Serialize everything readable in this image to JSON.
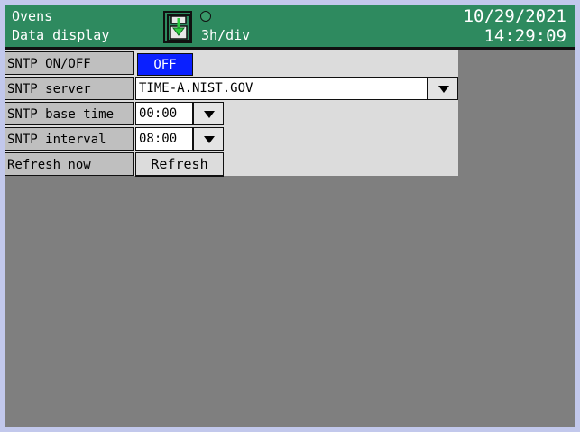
{
  "header": {
    "title": "Ovens",
    "subtitle": "Data display",
    "time_per_div": "3h/div",
    "date": "10/29/2021",
    "time": "14:29:09",
    "save_icon": "save-download-icon",
    "status_icon": "status-dot-icon",
    "bg_color": "#2e8a5f"
  },
  "settings": {
    "sntp_on_off": {
      "label": "SNTP ON/OFF",
      "value": "OFF",
      "value_color": "#0a20ff"
    },
    "sntp_server": {
      "label": "SNTP server",
      "value": "TIME-A.NIST.GOV"
    },
    "sntp_base_time": {
      "label": "SNTP base time",
      "value": "00:00"
    },
    "sntp_interval": {
      "label": "SNTP interval",
      "value": "08:00"
    },
    "refresh_now": {
      "label": "Refresh now",
      "button": "Refresh"
    }
  },
  "dropdown_icon": "triangle-down-icon"
}
